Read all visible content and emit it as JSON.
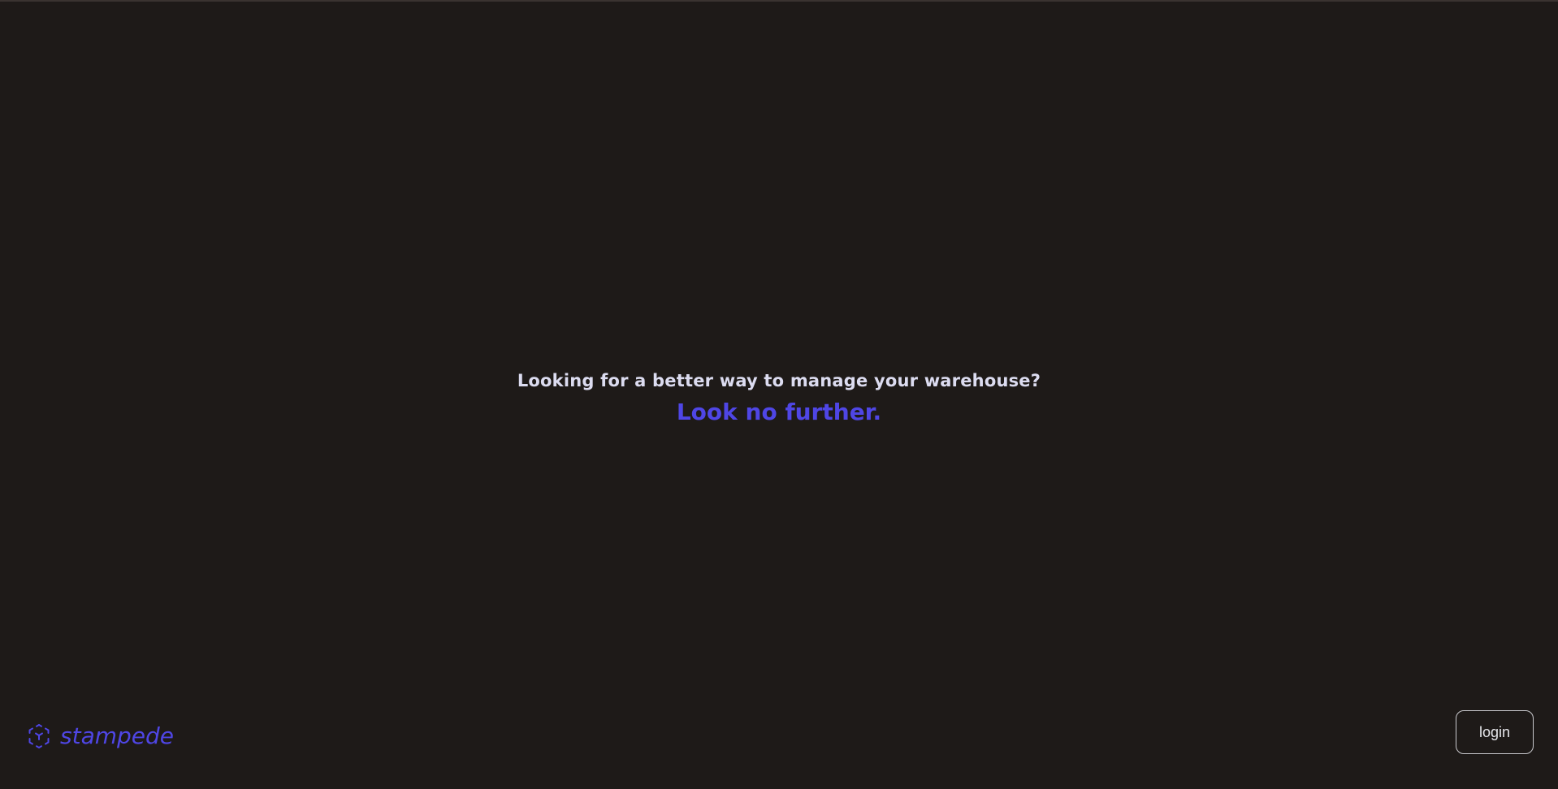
{
  "colors": {
    "background": "#1e1a18",
    "accent": "#4f46e5",
    "text": "#dcdcf0",
    "button_border": "#c8c8cc"
  },
  "hero": {
    "question": "Looking for a better way to manage your warehouse?",
    "answer": "Look no further."
  },
  "brand": {
    "icon": "cube-icon",
    "name": "stampede"
  },
  "login": {
    "label": "login"
  }
}
